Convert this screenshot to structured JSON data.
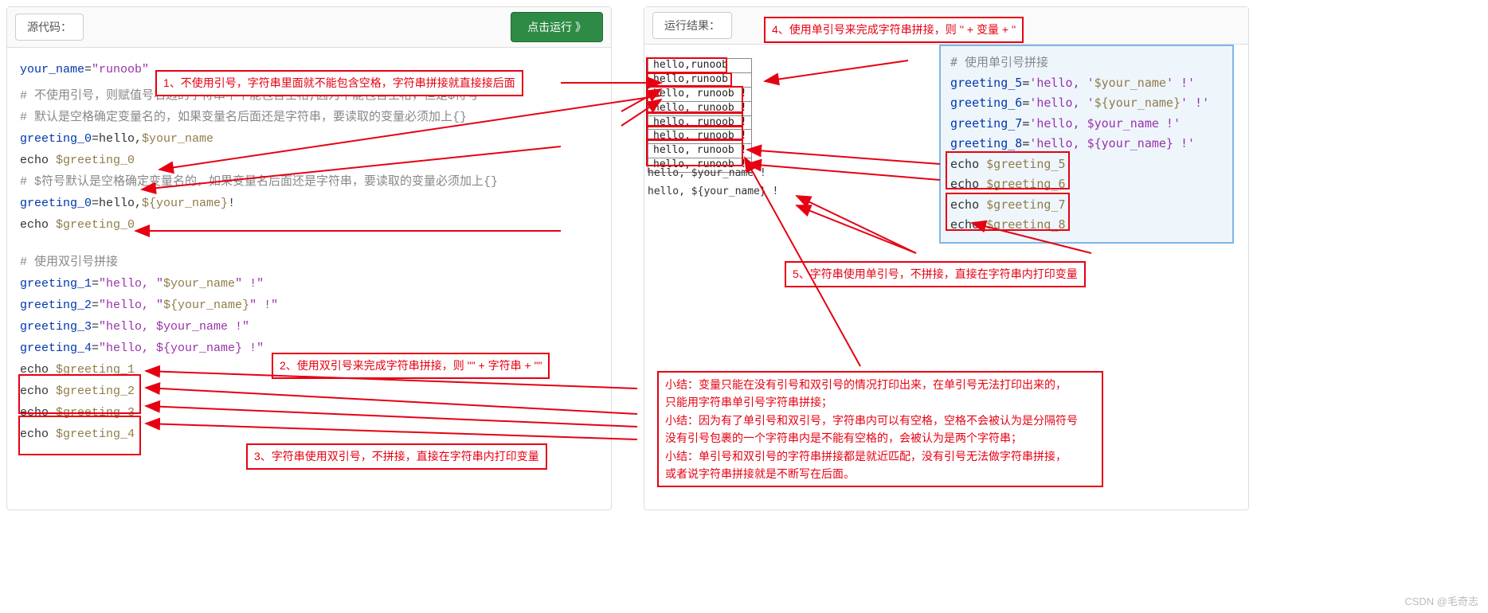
{
  "left": {
    "header_label": "源代码：",
    "run_button": "点击运行 》"
  },
  "right": {
    "header_label": "运行结果："
  },
  "code_left": {
    "l1a": "your_name",
    "l1b": "=",
    "l1c": "\"runoob\"",
    "c1": "# 不使用引号，则赋值号右边的字符串中不能包含空格,因为不能包含空格，但是$符号",
    "c2": "# 默认是空格确定变量名的，如果变量名后面还是字符串，要读取的变量必须加上{}",
    "l2a": "greeting_0",
    "l2b": "=hello,",
    "l2c": "$your_name",
    "l3a": "echo ",
    "l3b": "$greeting_0",
    "c3": "# $符号默认是空格确定变量名的，如果变量名后面还是字符串，要读取的变量必须加上{}",
    "l4a": "greeting_0",
    "l4b": "=hello,",
    "l4c": "${your_name}",
    "l4d": "!",
    "l5a": "echo ",
    "l5b": "$greeting_0",
    "c4": "# 使用双引号拼接",
    "l6a": "greeting_1",
    "l6b": "=",
    "l6c": "\"hello, \"",
    "l6d": "$your_name",
    "l6e": "\" !\"",
    "l7a": "greeting_2",
    "l7b": "=",
    "l7c": "\"hello, \"",
    "l7d": "${your_name}",
    "l7e": "\" !\"",
    "l8a": "greeting_3",
    "l8b": "=",
    "l8c": "\"hello, $your_name !\"",
    "l9a": "greeting_4",
    "l9b": "=",
    "l9c": "\"hello, ${your_name} !\"",
    "l10a": "echo ",
    "l10b": "$greeting_1",
    "l11a": "echo ",
    "l11b": "$greeting_2",
    "l12a": "echo ",
    "l12b": "$greeting_3",
    "l13a": "echo ",
    "l13b": "$greeting_4"
  },
  "annot": {
    "a1": "1、不使用引号，字符串里面就不能包含空格，字符串拼接就直接接后面",
    "a2": "2、使用双引号来完成字符串拼接，则 \"\" + 字符串 + \"\"",
    "a3": "3、字符串使用双引号，不拼接，直接在字符串内打印变量",
    "a4": "4、使用单引号来完成字符串拼接，则 '' + 变量 + ''",
    "a5": "5、字符串使用单引号，不拼接，直接在字符串内打印变量"
  },
  "output": {
    "o1": "hello,runoob",
    "o2": "hello,runoob!",
    "o3": "hello, runoob !",
    "o4": "hello, runoob !",
    "o5": "hello, runoob !",
    "o6": "hello, runoob !",
    "o7": "hello, runoob !",
    "o8": "hello, runoob !",
    "o9": "hello, $your_name !",
    "o10": "hello, ${your_name} !"
  },
  "code_right": {
    "c1": "# 使用单引号拼接",
    "l1a": "greeting_5",
    "l1b": "=",
    "l1c": "'hello, '",
    "l1d": "$your_name",
    "l1e": "' !'",
    "l2a": "greeting_6",
    "l2b": "=",
    "l2c": "'hello, '",
    "l2d": "${your_name}",
    "l2e": "' !'",
    "l3a": "greeting_7",
    "l3b": "=",
    "l3c": "'hello, $your_name !'",
    "l4a": "greeting_8",
    "l4b": "=",
    "l4c": "'hello, ${your_name} !'",
    "l5a": "echo ",
    "l5b": "$greeting_5",
    "l6a": "echo ",
    "l6b": "$greeting_6",
    "l7a": "echo ",
    "l7b": "$greeting_7",
    "l8a": "echo ",
    "l8b": "$greeting_8"
  },
  "summary": {
    "s1": "小结：变量只能在没有引号和双引号的情况打印出来，在单引号无法打印出来的，",
    "s2": "只能用字符串单引号字符串拼接；",
    "s3": "小结：因为有了单引号和双引号，字符串内可以有空格，空格不会被认为是分隔符号",
    "s4": "没有引号包裹的一个字符串内是不能有空格的，会被认为是两个字符串；",
    "s5": "小结：单引号和双引号的字符串拼接都是就近匹配，没有引号无法做字符串拼接，",
    "s6": "或者说字符串拼接就是不断写在后面。"
  },
  "watermark": "CSDN @毛奇志"
}
